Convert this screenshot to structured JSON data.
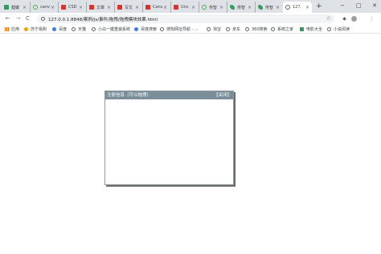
{
  "browser": {
    "tabs": [
      {
        "label": "螳螂",
        "favicon": "green-square-icon",
        "active": false
      },
      {
        "label": "canv",
        "favicon": "green-ring-icon",
        "active": false
      },
      {
        "label": "CSD",
        "favicon": "red-c-icon",
        "active": false
      },
      {
        "label": "文章",
        "favicon": "red-c-icon",
        "active": false
      },
      {
        "label": "写文",
        "favicon": "red-c-icon",
        "active": false
      },
      {
        "label": "Canv",
        "favicon": "red-c-icon",
        "active": false
      },
      {
        "label": "Unc",
        "favicon": "red-c-icon",
        "active": false
      },
      {
        "label": "传智",
        "favicon": "green-ring-icon",
        "active": false
      },
      {
        "label": "传智",
        "favicon": "green-bird-icon",
        "active": false
      },
      {
        "label": "传智",
        "favicon": "green-bird-icon",
        "active": false
      },
      {
        "label": "127.",
        "favicon": "globe-icon",
        "active": true
      }
    ],
    "new_tab_label": "+",
    "window_controls": {
      "minimize": "−",
      "maximize": "□",
      "close": "✕"
    },
    "nav": {
      "back": "←",
      "forward": "→",
      "reload": "C"
    },
    "address_bar": {
      "url": "127.0.0.1:8848/案例/js/事件/拖拽/拖拽模块效果.html"
    },
    "bookmarks": [
      {
        "label": "应用",
        "icon": "apps-grid-icon"
      },
      {
        "label": "苏宁易购",
        "icon": "orange-dot-icon"
      },
      {
        "label": "百度",
        "icon": "blue-paw-icon"
      },
      {
        "label": "天猫",
        "icon": "globe-icon"
      },
      {
        "label": "小白一键重装系统",
        "icon": "globe-icon"
      },
      {
        "label": "百度搜索",
        "icon": "blue-paw-icon"
      },
      {
        "label": "搜狗网址导航 - ...",
        "icon": "globe-icon"
      },
      {
        "label": "淘宝",
        "icon": "globe-icon"
      },
      {
        "label": "京东",
        "icon": "globe-icon"
      },
      {
        "label": "360搜索",
        "icon": "globe-icon"
      },
      {
        "label": "系统之家",
        "icon": "globe-icon"
      },
      {
        "label": "电影大全",
        "icon": "green-square-icon"
      },
      {
        "label": "小说阅读",
        "icon": "globe-icon"
      }
    ]
  },
  "dialog": {
    "title": "注册信息（可以拖拽）",
    "close_label": "【关闭】"
  },
  "colors": {
    "tab_strip": "#dee1e6",
    "dialog_header": "#7a8e99",
    "dialog_border": "#8f9aa0"
  }
}
